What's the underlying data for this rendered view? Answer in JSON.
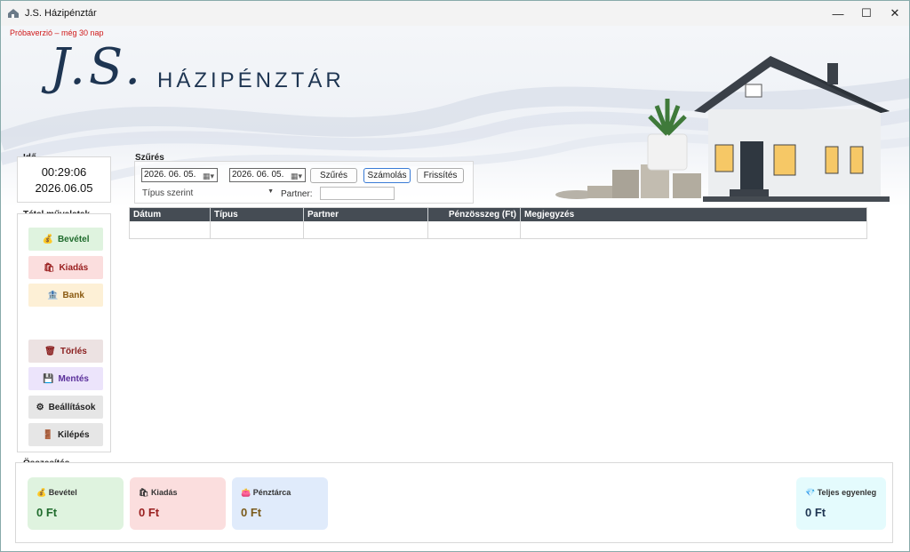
{
  "window": {
    "title": "J.S. Házipénztár",
    "controls": {
      "minimize": "—",
      "maximize": "☐",
      "close": "✕"
    }
  },
  "banner": {
    "trial_notice": "Próbaverzió – még 30 nap",
    "logo_mark": "J.S.",
    "logo_text": "HÁZIPÉNZTÁR"
  },
  "time_panel": {
    "label": "Idő",
    "time": "00:29:06",
    "date": "2026.06.05"
  },
  "filter": {
    "label": "Szűrés",
    "date_from": "2026. 06. 05.",
    "date_to": "2026. 06. 05.",
    "buttons": {
      "filter": "Szűrés",
      "calculate": "Számolás",
      "refresh": "Frissítés"
    },
    "type_select": "Típus szerint",
    "partner_label": "Partner:",
    "partner_value": ""
  },
  "operations": {
    "label": "Tétel műveletek",
    "buttons": {
      "income": "Bevétel",
      "expense": "Kiadás",
      "bank": "Bank",
      "delete": "Törlés",
      "save": "Mentés",
      "settings": "Beállítások",
      "exit": "Kilépés"
    }
  },
  "table": {
    "columns": [
      "Dátum",
      "Típus",
      "Partner",
      "Pénzösszeg (Ft)",
      "Megjegyzés"
    ],
    "rows": []
  },
  "summary": {
    "label": "Összesítés",
    "cards": {
      "income": {
        "label": "Bevétel",
        "value": "0 Ft"
      },
      "expense": {
        "label": "Kiadás",
        "value": "0 Ft"
      },
      "wallet": {
        "label": "Pénztárca",
        "value": "0 Ft"
      },
      "total": {
        "label": "Teljes egyenleg",
        "value": "0 Ft"
      }
    }
  },
  "colors": {
    "brand": "#1e3552",
    "income_bg": "#dff3df",
    "income_text": "#1f6b2c",
    "expense_bg": "#fbdede",
    "expense_text": "#9a2020",
    "bank_bg": "#fdf0d6",
    "bank_text": "#8a5a10",
    "delete_bg": "#ece2e2",
    "delete_text": "#8a1e1e",
    "save_bg": "#ece4fb",
    "save_text": "#5a2f9a",
    "neutral_bg": "#e6e6e6",
    "wallet_bg": "#e0ebfb",
    "wallet_text": "#7a5a1a",
    "total_bg": "#e4fbfd",
    "total_text": "#1e3552",
    "trial": "#d01a1a"
  }
}
